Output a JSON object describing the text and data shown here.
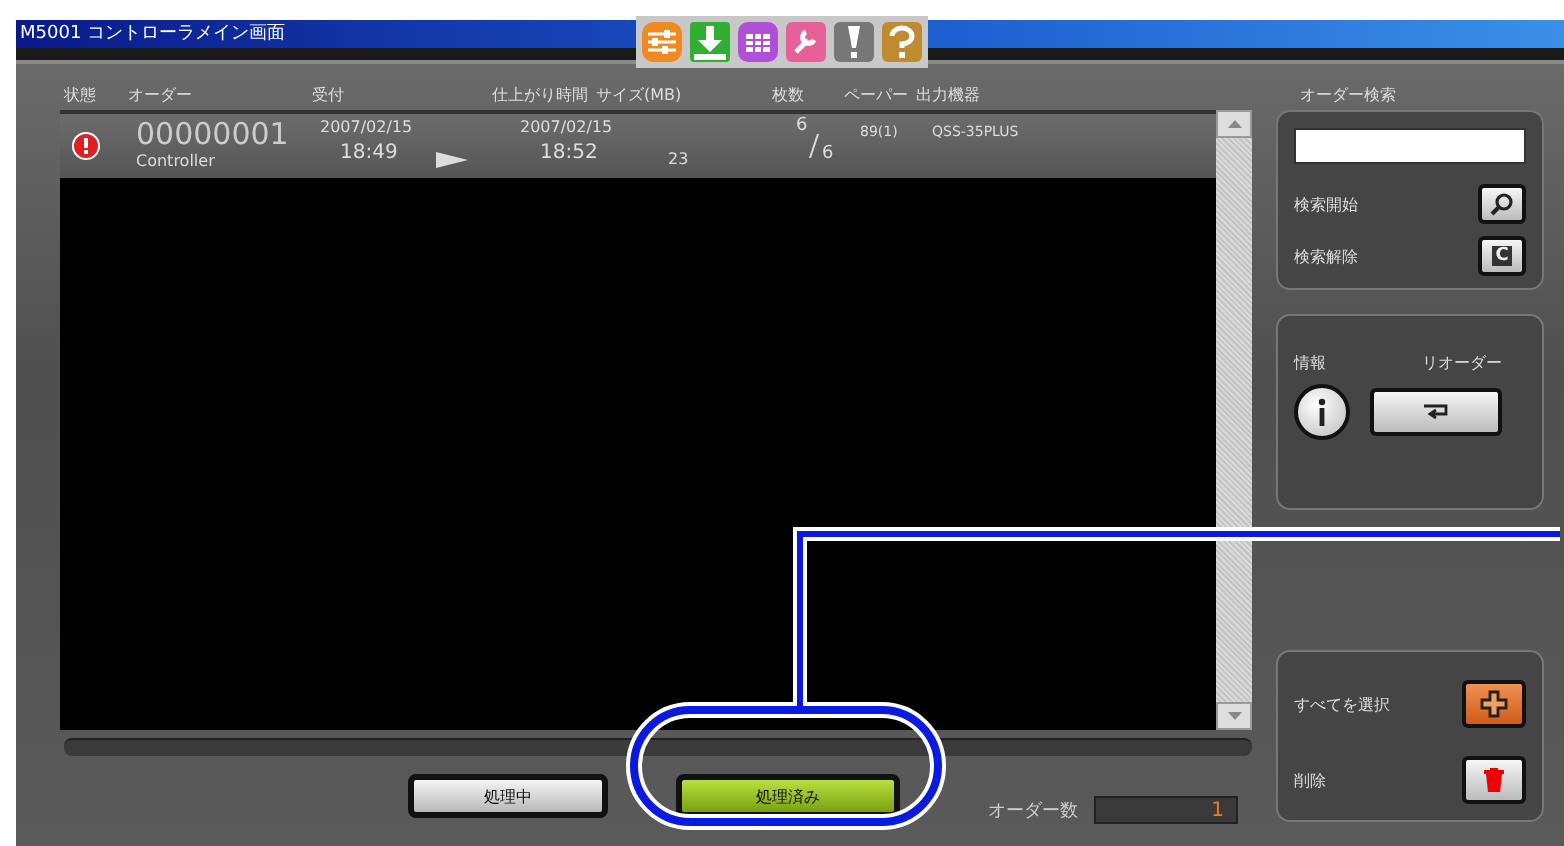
{
  "window": {
    "title": "M5001 コントローラメイン画面"
  },
  "table": {
    "columns": [
      "状態",
      "オーダー",
      "受付",
      "仕上がり時間",
      "サイズ(MB)",
      "枚数",
      "ペーパー",
      "出力機器"
    ],
    "rows": [
      {
        "kind": "error",
        "order": "00000001",
        "source": "Controller",
        "received_date": "2007/02/15",
        "received_time": "18:49",
        "finish_date": "2007/02/15",
        "finish_time": "18:52",
        "size": "23",
        "sheets_done": "6",
        "sheets_total": "6",
        "paper": "89(1)",
        "device": "QSS-35PLUS",
        "selected": true
      }
    ]
  },
  "status_buttons": [
    {
      "label": "処理中",
      "selected": false
    },
    {
      "label": "処理済み",
      "selected": true
    }
  ],
  "order_count": {
    "label": "オーダー数",
    "value": "1"
  },
  "search": {
    "title": "オーダー検索",
    "start_label": "検索開始",
    "clear_label": "検索解除",
    "clear_key": "C"
  },
  "info": {
    "label": "情報",
    "reorder_label": "リオーダー"
  },
  "actions": {
    "select_all_label": "すべてを選択",
    "delete_label": "削除"
  }
}
